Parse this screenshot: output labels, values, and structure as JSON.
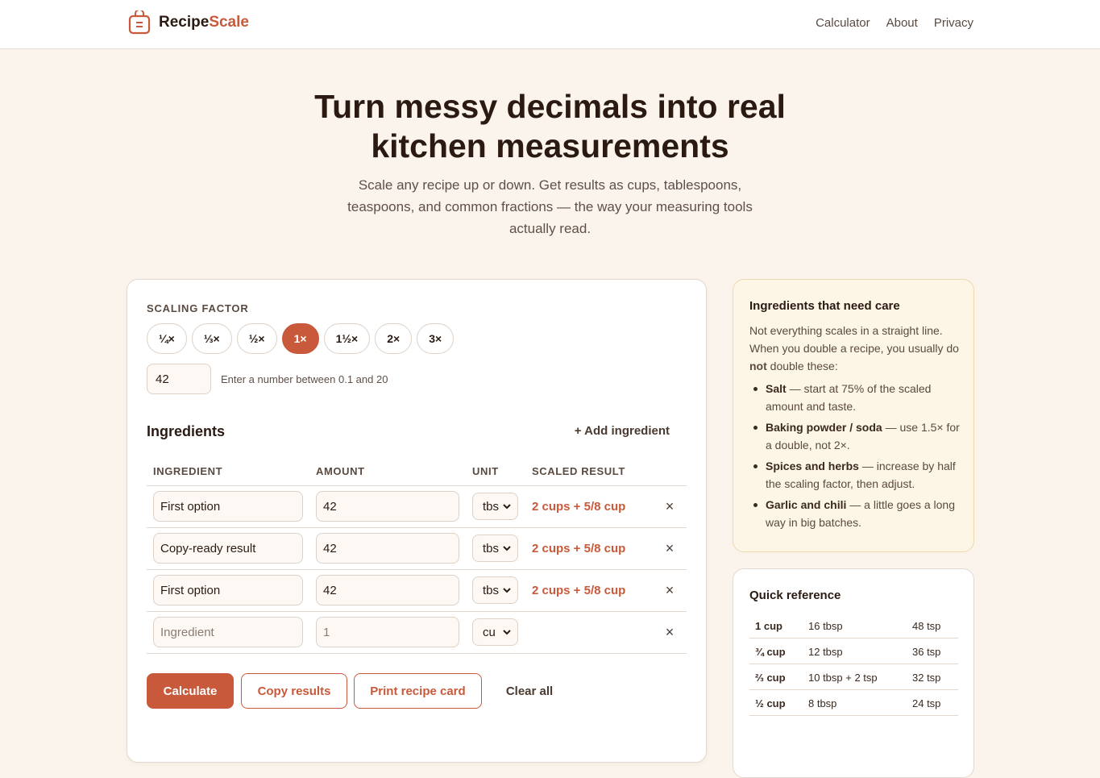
{
  "brand": {
    "name_part1": "Recipe",
    "name_part2": "Scale"
  },
  "nav": {
    "items": [
      "Calculator",
      "About",
      "Privacy"
    ]
  },
  "hero": {
    "title_line1": "Turn messy decimals into real",
    "title_line2": "kitchen measurements",
    "subtitle_line1": "Scale any recipe up or down. Get results as cups, tablespoons,",
    "subtitle_line2": "teaspoons, and common fractions — the way your measuring tools",
    "subtitle_line3": "actually read."
  },
  "scaling": {
    "label": "SCALING FACTOR",
    "chips": [
      "¼×",
      "⅓×",
      "½×",
      "1×",
      "1½×",
      "2×",
      "3×"
    ],
    "active_chip": "1×",
    "factor_value": "42",
    "hint": "Enter a number between 0.1 and 20"
  },
  "ingredients": {
    "title": "Ingredients",
    "add_label": "+ Add ingredient",
    "headers": {
      "ingredient": "INGREDIENT",
      "amount": "AMOUNT",
      "unit": "UNIT",
      "scaled": "SCALED RESULT"
    },
    "rows": [
      {
        "name": "First option",
        "amount": "42",
        "unit": "tbs",
        "scaled": "2 cups + 5/8 cup"
      },
      {
        "name": "Copy-ready result",
        "amount": "42",
        "unit": "tbs",
        "scaled": "2 cups + 5/8 cup"
      },
      {
        "name": "First option",
        "amount": "42",
        "unit": "tbs",
        "scaled": "2 cups + 5/8 cup"
      },
      {
        "name": "",
        "name_placeholder": "Ingredient",
        "amount": "",
        "amount_placeholder": "1",
        "unit": "cu",
        "scaled": ""
      }
    ],
    "remove_glyph": "×"
  },
  "actions": {
    "calculate": "Calculate",
    "copy": "Copy results",
    "print": "Print recipe card",
    "clear": "Clear all"
  },
  "care": {
    "title": "Ingredients that need care",
    "intro_before": "Not everything scales in a straight line. When you double a recipe, you usually do ",
    "intro_bold": "not",
    "intro_after": " double these:",
    "items": [
      {
        "term": "Salt",
        "text": " — start at 75% of the scaled amount and taste."
      },
      {
        "term": "Baking powder / soda",
        "text": " — use 1.5× for a double, not 2×."
      },
      {
        "term": "Spices and herbs",
        "text": " — increase by half the scaling factor, then adjust."
      },
      {
        "term": "Garlic and chili",
        "text": " — a little goes a long way in big batches."
      }
    ]
  },
  "reference": {
    "title": "Quick reference",
    "rows": [
      [
        "1 cup",
        "16 tbsp",
        "48 tsp"
      ],
      [
        "¾ cup",
        "12 tbsp",
        "36 tsp"
      ],
      [
        "⅔ cup",
        "10 tbsp + 2 tsp",
        "32 tsp"
      ],
      [
        "½ cup",
        "8 tbsp",
        "24 tsp"
      ]
    ]
  },
  "colors": {
    "accent": "#c8593a",
    "background": "#fbf4ec",
    "care_bg": "#fdf5e6"
  },
  "icons": {
    "brand": "recipe-box-icon",
    "select": "chevron-down-icon",
    "remove": "close-icon"
  }
}
